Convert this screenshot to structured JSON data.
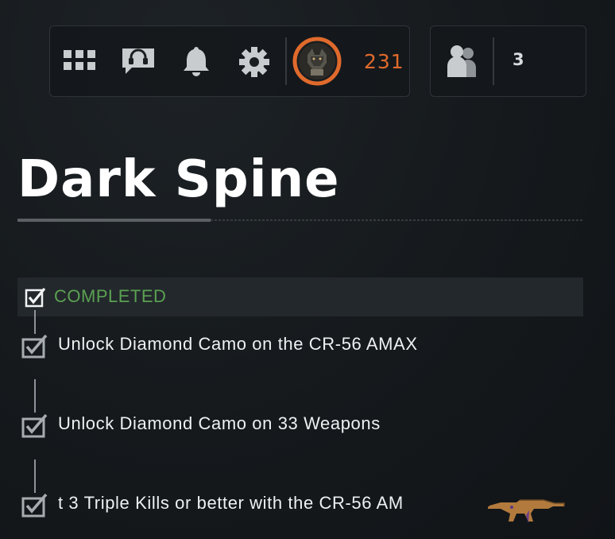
{
  "topbar": {
    "icons": [
      "grid-menu-icon",
      "headset-chat-icon",
      "bell-icon",
      "gear-icon"
    ],
    "level": "231",
    "colors": {
      "level_ring": "#e06a2c",
      "level_text": "#e06a2c"
    }
  },
  "party": {
    "icon": "party-members-icon",
    "count": "3"
  },
  "page": {
    "title": "Dark Spine"
  },
  "status": {
    "label": "COMPLETED",
    "color": "#5aa152"
  },
  "tasks": [
    {
      "text": "Unlock Diamond Camo on the CR-56 AMAX",
      "checked": true
    },
    {
      "text": "Unlock Diamond Camo on 33 Weapons",
      "checked": true
    },
    {
      "text": "t 3 Triple Kills or better with the CR-56 AM",
      "checked": true
    }
  ]
}
